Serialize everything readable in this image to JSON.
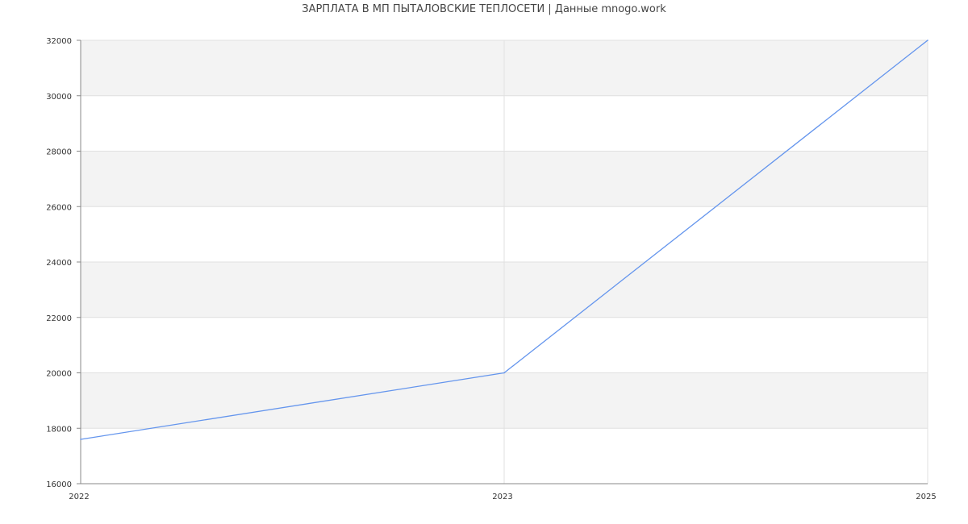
{
  "chart_data": {
    "type": "line",
    "title": "ЗАРПЛАТА В МП ПЫТАЛОВСКИЕ ТЕПЛОСЕТИ | Данные mnogo.work",
    "xlabel": "",
    "ylabel": "",
    "x_ticks": [
      "2022",
      "2023",
      "2025"
    ],
    "x": [
      "2022",
      "2023",
      "2025"
    ],
    "xlim": [
      "2022",
      "2025"
    ],
    "ylim": [
      16000,
      32000
    ],
    "y_ticks": [
      16000,
      18000,
      20000,
      22000,
      24000,
      26000,
      28000,
      30000,
      32000
    ],
    "grid": true,
    "alternating_bands": true,
    "series": [
      {
        "values": [
          17600,
          20000,
          32000
        ],
        "color": "#6495ed"
      }
    ],
    "colors": {
      "band": "#f3f3f3",
      "grid": "#e0e0e0",
      "axis": "#888888",
      "line": "#6495ed"
    }
  }
}
